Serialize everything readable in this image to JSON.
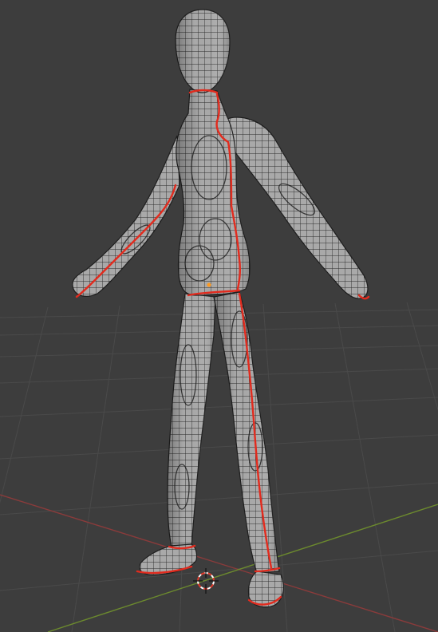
{
  "viewport": {
    "kind": "3d-viewport",
    "background_color": "#3d3d3d",
    "grid_color": "#4a4a4a",
    "x_axis_color": "#8a3b3b",
    "y_axis_color": "#6c8a2e"
  },
  "scene": {
    "object": "mannequin-mesh",
    "mode": "edit-mode",
    "mesh_fill_color": "#a6a6a6",
    "wire_color": "#2a2a2a",
    "seam_color": "#e22b1e",
    "selected_vertex_color": "#ff9a1f"
  },
  "cursor": {
    "name": "3d-cursor",
    "ring_colors": [
      "#ffffff",
      "#e03a2a"
    ]
  }
}
